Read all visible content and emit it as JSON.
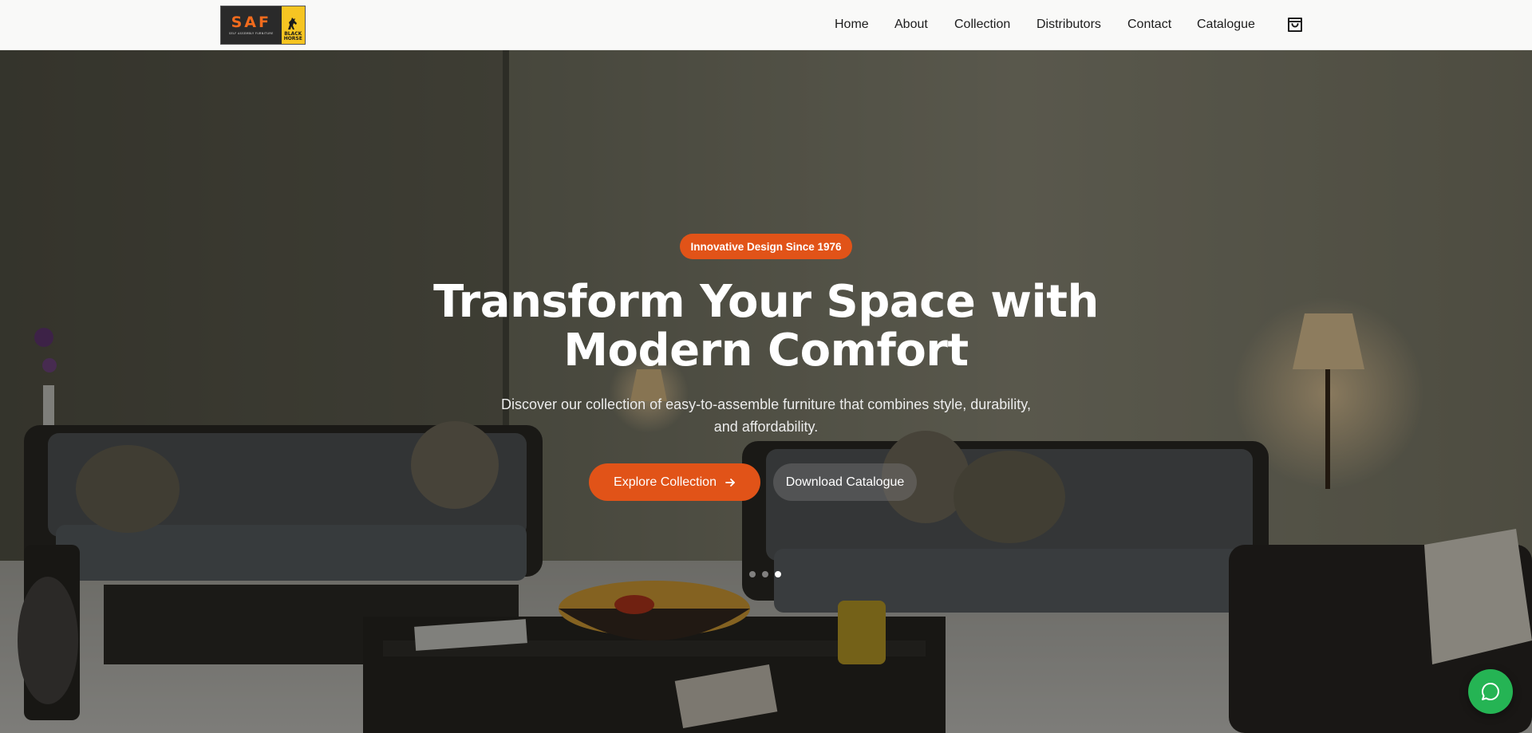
{
  "brand": {
    "logo_text": "SAF",
    "logo_tagline": "SELF ASSEMBLY FURNITURE",
    "logo_badge_line1": "BLACK",
    "logo_badge_line2": "HORSE"
  },
  "nav": {
    "items": [
      {
        "label": "Home"
      },
      {
        "label": "About"
      },
      {
        "label": "Collection"
      },
      {
        "label": "Distributors"
      },
      {
        "label": "Contact"
      },
      {
        "label": "Catalogue"
      }
    ],
    "cart_icon": "shopping-bag-icon"
  },
  "hero": {
    "badge": "Innovative Design Since 1976",
    "headline_line1": "Transform Your Space with",
    "headline_line2": "Modern Comfort",
    "subtext_line1": "Discover our collection of easy-to-assemble furniture that combines style, durability,",
    "subtext_line2": "and affordability.",
    "primary_cta": "Explore Collection",
    "secondary_cta": "Download Catalogue",
    "slides_total": 3,
    "active_slide": 3
  },
  "chat": {
    "icon": "chat-bubble-icon"
  },
  "colors": {
    "accent": "#e15318",
    "chat": "#25b454",
    "header_bg": "#f9f9f8"
  }
}
